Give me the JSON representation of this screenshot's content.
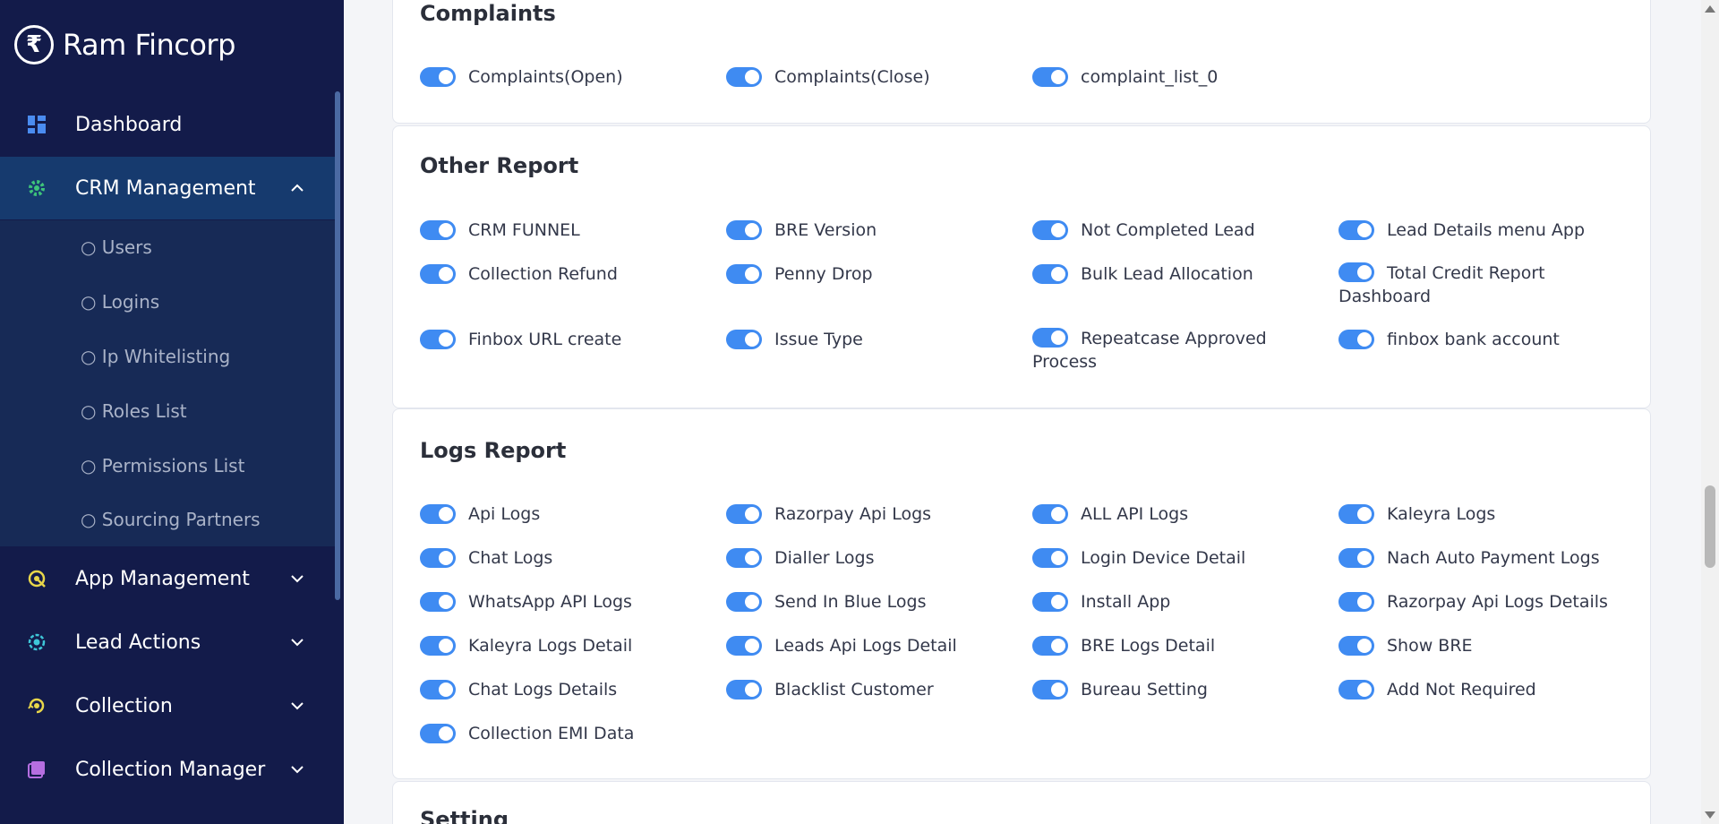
{
  "app": {
    "brand_symbol": "₹",
    "brand_name": "Ram Fincorp"
  },
  "sidebar": {
    "dashboard": "Dashboard",
    "crm_management": "CRM Management",
    "crm_submenu": [
      "○ Users",
      "○ Logins",
      "○ Ip Whitelisting",
      "○ Roles List",
      "○ Permissions List",
      "○ Sourcing Partners"
    ],
    "app_management": "App Management",
    "lead_actions": "Lead Actions",
    "collection": "Collection",
    "collection_manager": "Collection Manager"
  },
  "colors": {
    "sidebar_bg": "#131b4a",
    "active_bg": "#163a6e",
    "toggle_on": "#3f8bf2"
  },
  "sections": {
    "complaints": {
      "title": "Complaints",
      "items": [
        "Complaints(Open)",
        "Complaints(Close)",
        "complaint_list_0"
      ]
    },
    "other_report": {
      "title": "Other Report",
      "items": [
        "CRM FUNNEL",
        "BRE Version",
        "Not Completed Lead",
        "Lead Details menu App",
        "Collection Refund",
        "Penny Drop",
        "Bulk Lead Allocation",
        "Total Credit Report Dashboard",
        "Finbox URL create",
        "Issue Type",
        "Repeatcase Approved Process",
        "finbox bank account"
      ]
    },
    "logs_report": {
      "title": "Logs Report",
      "items": [
        "Api Logs",
        "Razorpay Api Logs",
        "ALL API Logs",
        "Kaleyra Logs",
        "Chat Logs",
        "Dialler Logs",
        "Login Device Detail",
        "Nach Auto Payment Logs",
        "WhatsApp API Logs",
        "Send In Blue Logs",
        "Install App",
        "Razorpay Api Logs Details",
        "Kaleyra Logs Detail",
        "Leads Api Logs Detail",
        "BRE Logs Detail",
        "Show BRE",
        "Chat Logs Details",
        "Blacklist Customer",
        "Bureau Setting",
        "Add Not Required",
        "Collection EMI Data"
      ]
    },
    "setting": {
      "title": "Setting"
    }
  }
}
